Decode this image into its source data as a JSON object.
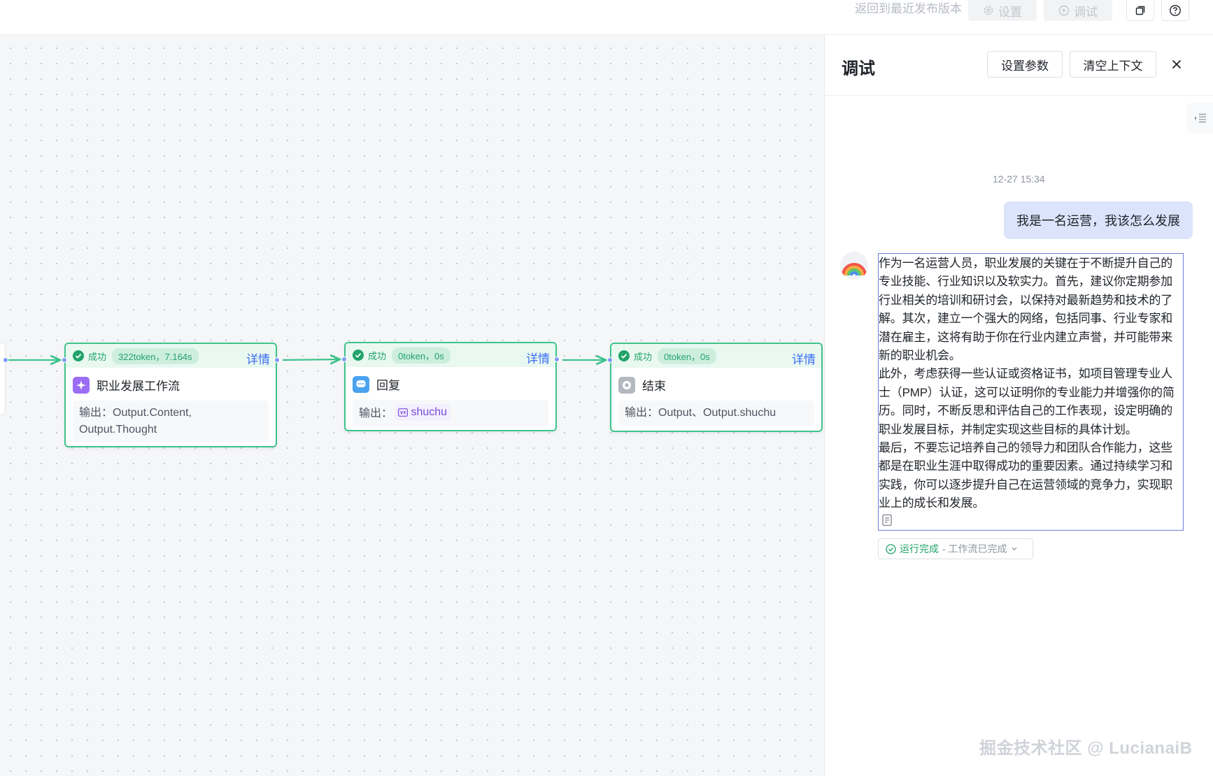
{
  "topbar": {
    "return_link": "返回到最近发布版本",
    "settings_label": "设置",
    "debug_label": "调试",
    "icons": [
      "gear-icon",
      "play-circle-icon",
      "copy-icon",
      "help-icon"
    ]
  },
  "canvas": {
    "nodes": [
      {
        "status": "成功",
        "metric": "322token，7.164s",
        "detail": "详情",
        "title": "职业发展工作流",
        "output_label": "输出：",
        "output_value": "Output.Content, Output.Thought",
        "icon": "sparkle-icon"
      },
      {
        "status": "成功",
        "metric": "0token，0s",
        "detail": "详情",
        "title": "回复",
        "output_label": "输出：",
        "output_value": "shuchu",
        "icon": "chat-bubble-icon"
      },
      {
        "status": "成功",
        "metric": "0token，0s",
        "detail": "详情",
        "title": "结束",
        "output_label": "输出：",
        "output_value": "Output、Output.shuchu",
        "icon": "stop-icon"
      }
    ]
  },
  "panel": {
    "title": "调试",
    "set_params": "设置参数",
    "clear_context": "清空上下文",
    "timestamp": "12-27 15:34",
    "user_message": "我是一名运营，我该怎么发展",
    "bot_paragraphs": [
      "作为一名运营人员，职业发展的关键在于不断提升自己的专业技能、行业知识以及软实力。首先，建议你定期参加行业相关的培训和研讨会，以保持对最新趋势和技术的了解。其次，建立一个强大的网络，包括同事、行业专家和潜在雇主，这将有助于你在行业内建立声誉，并可能带来新的职业机会。",
      "此外，考虑获得一些认证或资格证书，如项目管理专业人士（PMP）认证，这可以证明你的专业能力并增强你的简历。同时，不断反思和评估自己的工作表现，设定明确的职业发展目标，并制定实现这些目标的具体计划。",
      "最后，不要忘记培养自己的领导力和团队合作能力，这些都是在职业生涯中取得成功的重要因素。通过持续学习和实践，你可以逐步提升自己在运营领域的竞争力，实现职业上的成长和发展。"
    ],
    "run_status": "运行完成",
    "run_status_sub": "- 工作流已完成"
  },
  "watermark": "掘金技术社区 @ LucianaiB",
  "colors": {
    "success": "#21a36a",
    "node_border": "#3ec38c",
    "link": "#3a6ef5",
    "user_bubble": "#dbe4fb"
  }
}
